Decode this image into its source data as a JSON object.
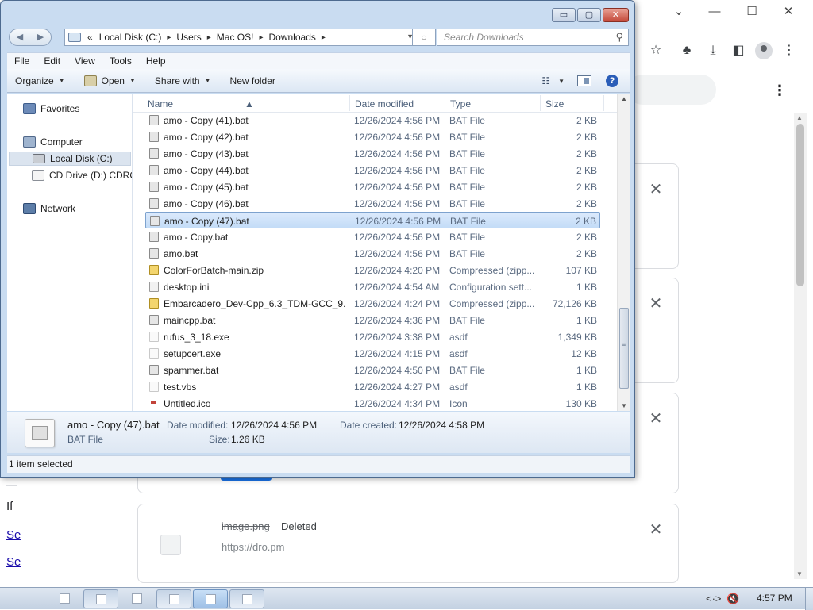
{
  "browser": {
    "controls": [
      "⌄",
      "—",
      "☐",
      "✕"
    ],
    "downloads": [
      {
        "name": "",
        "status": "",
        "url": ""
      },
      {
        "name": "",
        "status": "",
        "url": ""
      },
      {
        "name": "",
        "status": "",
        "url": ""
      },
      {
        "name": "",
        "status": "",
        "url": ""
      },
      {
        "name": "image.png",
        "status": "Deleted",
        "url": "https://dro.pm"
      }
    ],
    "left_fragments": [
      "If",
      "Se",
      "Se"
    ],
    "close_glyph": "✕"
  },
  "explorer": {
    "caption": {
      "minimize": "▭",
      "maximize": "▢",
      "close": "✕"
    },
    "address": {
      "overflow": "«",
      "crumbs": [
        "Local Disk (C:)",
        "Users",
        "Mac OS!",
        "Downloads"
      ]
    },
    "search": {
      "placeholder": "Search Downloads"
    },
    "menu": [
      "File",
      "Edit",
      "View",
      "Tools",
      "Help"
    ],
    "commands": {
      "organize": "Organize",
      "open": "Open",
      "share_with": "Share with",
      "new_folder": "New folder",
      "help": "?"
    },
    "nav": {
      "favorites": "Favorites",
      "computer": "Computer",
      "local_disk": "Local Disk (C:)",
      "cd_drive": "CD Drive (D:) CDROM",
      "network": "Network"
    },
    "columns": {
      "name": "Name",
      "date": "Date modified",
      "type": "Type",
      "size": "Size"
    },
    "files": [
      {
        "name": "amo - Copy (41).bat",
        "date": "12/26/2024 4:56 PM",
        "type": "BAT File",
        "size": "2 KB",
        "icon": "bat"
      },
      {
        "name": "amo - Copy (42).bat",
        "date": "12/26/2024 4:56 PM",
        "type": "BAT File",
        "size": "2 KB",
        "icon": "bat"
      },
      {
        "name": "amo - Copy (43).bat",
        "date": "12/26/2024 4:56 PM",
        "type": "BAT File",
        "size": "2 KB",
        "icon": "bat"
      },
      {
        "name": "amo - Copy (44).bat",
        "date": "12/26/2024 4:56 PM",
        "type": "BAT File",
        "size": "2 KB",
        "icon": "bat"
      },
      {
        "name": "amo - Copy (45).bat",
        "date": "12/26/2024 4:56 PM",
        "type": "BAT File",
        "size": "2 KB",
        "icon": "bat"
      },
      {
        "name": "amo - Copy (46).bat",
        "date": "12/26/2024 4:56 PM",
        "type": "BAT File",
        "size": "2 KB",
        "icon": "bat"
      },
      {
        "name": "amo - Copy (47).bat",
        "date": "12/26/2024 4:56 PM",
        "type": "BAT File",
        "size": "2 KB",
        "icon": "bat",
        "selected": true
      },
      {
        "name": "amo - Copy.bat",
        "date": "12/26/2024 4:56 PM",
        "type": "BAT File",
        "size": "2 KB",
        "icon": "bat"
      },
      {
        "name": "amo.bat",
        "date": "12/26/2024 4:56 PM",
        "type": "BAT File",
        "size": "2 KB",
        "icon": "bat"
      },
      {
        "name": "ColorForBatch-main.zip",
        "date": "12/26/2024 4:20 PM",
        "type": "Compressed (zipp...",
        "size": "107 KB",
        "icon": "zip"
      },
      {
        "name": "desktop.ini",
        "date": "12/26/2024 4:54 AM",
        "type": "Configuration sett...",
        "size": "1 KB",
        "icon": "ini"
      },
      {
        "name": "Embarcadero_Dev-Cpp_6.3_TDM-GCC_9....",
        "date": "12/26/2024 4:24 PM",
        "type": "Compressed (zipp...",
        "size": "72,126 KB",
        "icon": "zip"
      },
      {
        "name": "maincpp.bat",
        "date": "12/26/2024 4:36 PM",
        "type": "BAT File",
        "size": "1 KB",
        "icon": "bat"
      },
      {
        "name": "rufus_3_18.exe",
        "date": "12/26/2024 3:38 PM",
        "type": "asdf",
        "size": "1,349 KB",
        "icon": "exe"
      },
      {
        "name": "setupcert.exe",
        "date": "12/26/2024 4:15 PM",
        "type": "asdf",
        "size": "12 KB",
        "icon": "exe"
      },
      {
        "name": "spammer.bat",
        "date": "12/26/2024 4:50 PM",
        "type": "BAT File",
        "size": "1 KB",
        "icon": "bat"
      },
      {
        "name": "test.vbs",
        "date": "12/26/2024 4:27 PM",
        "type": "asdf",
        "size": "1 KB",
        "icon": "exe"
      },
      {
        "name": "Untitled.ico",
        "date": "12/26/2024 4:34 PM",
        "type": "Icon",
        "size": "130 KB",
        "icon": "ico"
      }
    ],
    "details": {
      "name": "amo - Copy (47).bat",
      "type": "BAT File",
      "date_modified_label": "Date modified:",
      "date_modified": "12/26/2024 4:56 PM",
      "date_created_label": "Date created:",
      "date_created": "12/26/2024 4:58 PM",
      "size_label": "Size:",
      "size": "1.26 KB"
    },
    "status": "1 item selected"
  },
  "taskbar": {
    "apple": "",
    "clock": "4:57 PM",
    "tray": [
      "<·>",
      "🔇"
    ]
  }
}
